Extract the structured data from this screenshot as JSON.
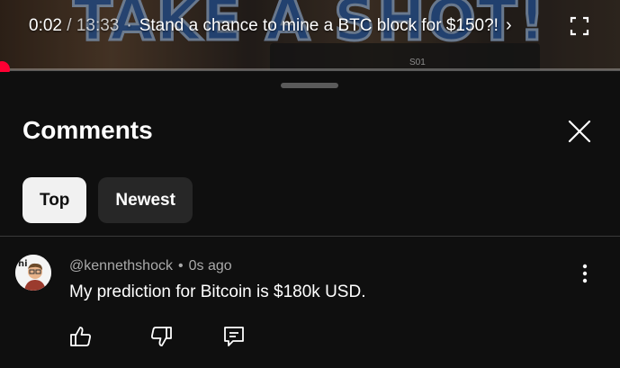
{
  "video": {
    "background_text": "TAKE A SHOT!",
    "board_label": "S01",
    "current_time": "0:02",
    "separator": " / ",
    "duration": "13:33",
    "title_separator": "·",
    "title": "Stand a chance to mine a BTC block for $150?!",
    "chevron": "›",
    "progress": 0.0025,
    "accent_color": "#ff0033"
  },
  "comments_sheet": {
    "heading": "Comments",
    "close_icon": "close-icon",
    "filters": [
      {
        "label": "Top",
        "selected": true
      },
      {
        "label": "Newest",
        "selected": false
      }
    ],
    "comments": [
      {
        "author": "@kennethshock",
        "meta_separator": "•",
        "time": "0s ago",
        "text": "My prediction for Bitcoin is $180k USD.",
        "avatar_text": "hi",
        "actions": [
          "like-icon",
          "dislike-icon",
          "reply-icon"
        ]
      }
    ]
  }
}
